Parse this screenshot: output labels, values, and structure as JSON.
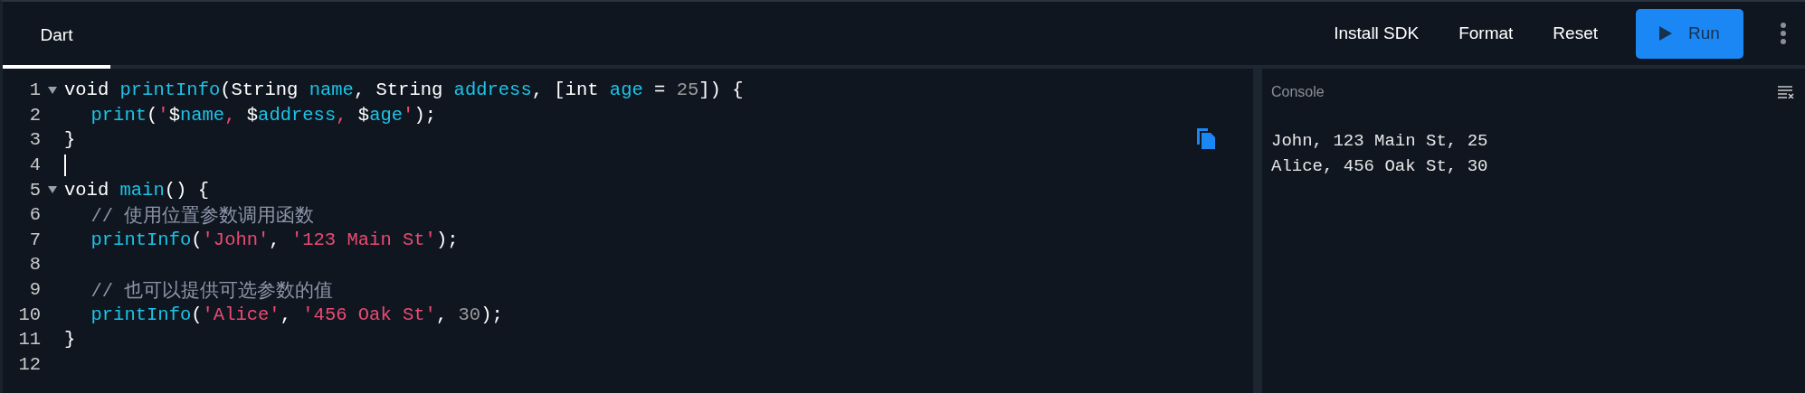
{
  "tabs": [
    {
      "label": "Dart",
      "selected": true
    }
  ],
  "toolbar": {
    "buttons": [
      {
        "label": "Install SDK",
        "kind": "text"
      },
      {
        "label": "Format",
        "kind": "text"
      },
      {
        "label": "Reset",
        "kind": "text"
      },
      {
        "label": "Run",
        "kind": "primary"
      }
    ]
  },
  "editor": {
    "lines": [
      {
        "number": "1",
        "foldable": true,
        "cursor": false,
        "indented": false,
        "tokens": [
          {
            "text": "void ",
            "kind": "plain"
          },
          {
            "text": "printInfo",
            "kind": "ident"
          },
          {
            "text": "(String ",
            "kind": "plain"
          },
          {
            "text": "name",
            "kind": "ident"
          },
          {
            "text": ", String ",
            "kind": "plain"
          },
          {
            "text": "address",
            "kind": "ident"
          },
          {
            "text": ", [int ",
            "kind": "plain"
          },
          {
            "text": "age",
            "kind": "ident"
          },
          {
            "text": " = ",
            "kind": "plain"
          },
          {
            "text": "25",
            "kind": "number"
          },
          {
            "text": "]) {",
            "kind": "plain"
          }
        ]
      },
      {
        "number": "2",
        "foldable": false,
        "cursor": false,
        "indented": true,
        "tokens": [
          {
            "text": "print",
            "kind": "ident"
          },
          {
            "text": "(",
            "kind": "plain"
          },
          {
            "text": "'",
            "kind": "string"
          },
          {
            "text": "$",
            "kind": "plain"
          },
          {
            "text": "name",
            "kind": "ident"
          },
          {
            "text": ", ",
            "kind": "string"
          },
          {
            "text": "$",
            "kind": "plain"
          },
          {
            "text": "address",
            "kind": "ident"
          },
          {
            "text": ", ",
            "kind": "string"
          },
          {
            "text": "$",
            "kind": "plain"
          },
          {
            "text": "age",
            "kind": "ident"
          },
          {
            "text": "'",
            "kind": "string"
          },
          {
            "text": ");",
            "kind": "plain"
          }
        ]
      },
      {
        "number": "3",
        "foldable": false,
        "cursor": false,
        "indented": false,
        "tokens": [
          {
            "text": "}",
            "kind": "plain"
          }
        ]
      },
      {
        "number": "4",
        "foldable": false,
        "cursor": true,
        "indented": false
      },
      {
        "number": "5",
        "foldable": true,
        "cursor": false,
        "indented": false,
        "tokens": [
          {
            "text": "void ",
            "kind": "plain"
          },
          {
            "text": "main",
            "kind": "ident"
          },
          {
            "text": "() {",
            "kind": "plain"
          }
        ]
      },
      {
        "number": "6",
        "foldable": false,
        "cursor": false,
        "indented": true,
        "tokens": [
          {
            "text": "// 使用位置参数调用函数",
            "kind": "comment"
          }
        ]
      },
      {
        "number": "7",
        "foldable": false,
        "cursor": false,
        "indented": true,
        "tokens": [
          {
            "text": "printInfo",
            "kind": "ident"
          },
          {
            "text": "(",
            "kind": "plain"
          },
          {
            "text": "'John'",
            "kind": "string"
          },
          {
            "text": ", ",
            "kind": "plain"
          },
          {
            "text": "'123 Main St'",
            "kind": "string"
          },
          {
            "text": ");",
            "kind": "plain"
          }
        ]
      },
      {
        "number": "8",
        "foldable": false,
        "cursor": false,
        "indented": false
      },
      {
        "number": "9",
        "foldable": false,
        "cursor": false,
        "indented": true,
        "tokens": [
          {
            "text": "// 也可以提供可选参数的值",
            "kind": "comment"
          }
        ]
      },
      {
        "number": "10",
        "foldable": false,
        "cursor": false,
        "indented": true,
        "tokens": [
          {
            "text": "printInfo",
            "kind": "ident"
          },
          {
            "text": "(",
            "kind": "plain"
          },
          {
            "text": "'Alice'",
            "kind": "string"
          },
          {
            "text": ", ",
            "kind": "plain"
          },
          {
            "text": "'456 Oak St'",
            "kind": "string"
          },
          {
            "text": ", ",
            "kind": "plain"
          },
          {
            "text": "30",
            "kind": "number"
          },
          {
            "text": ");",
            "kind": "plain"
          }
        ]
      },
      {
        "number": "11",
        "foldable": false,
        "cursor": false,
        "indented": false,
        "tokens": [
          {
            "text": "}",
            "kind": "plain"
          }
        ]
      },
      {
        "number": "12",
        "foldable": false,
        "cursor": false,
        "indented": false
      }
    ]
  },
  "console": {
    "title": "Console",
    "output": [
      "John, 123 Main St, 25",
      "Alice, 456 Oak St, 30"
    ]
  }
}
